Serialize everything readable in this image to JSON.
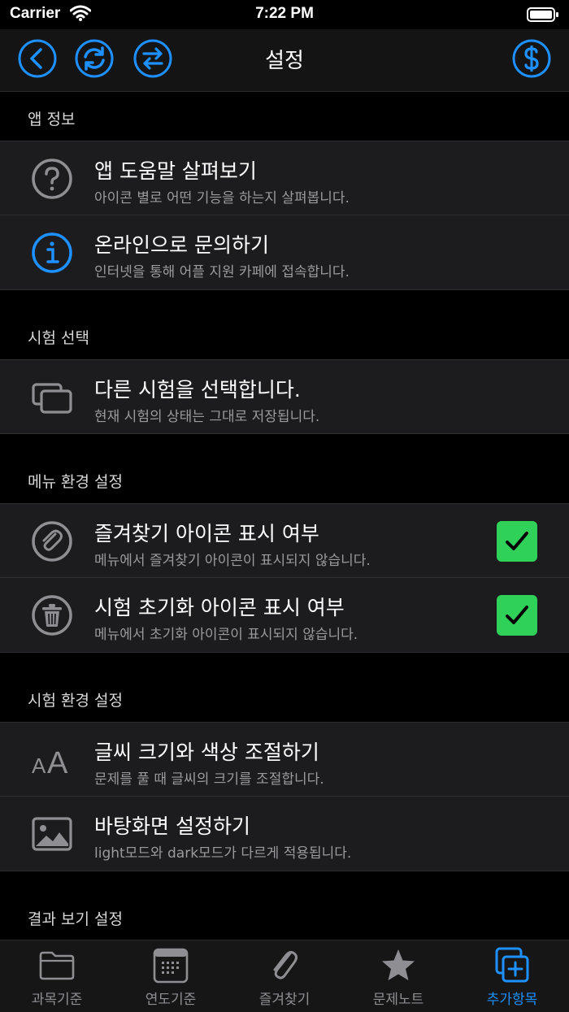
{
  "status_bar": {
    "carrier": "Carrier",
    "time": "7:22 PM"
  },
  "nav": {
    "title": "설정"
  },
  "colors": {
    "accent": "#1e90ff",
    "check": "#30d158",
    "row_bg": "#1c1c1e"
  },
  "sections": [
    {
      "header": "앱 정보",
      "rows": [
        {
          "title": "앱 도움말 살펴보기",
          "subtitle": "아이콘 별로 어떤 기능을 하는지 살펴봅니다.",
          "icon": "question-circle-icon"
        },
        {
          "title": "온라인으로 문의하기",
          "subtitle": "인터넷을 통해 어플 지원 카페에 접속합니다.",
          "icon": "info-circle-icon"
        }
      ]
    },
    {
      "header": "시험 선택",
      "rows": [
        {
          "title": "다른 시험을 선택합니다.",
          "subtitle": "현재 시험의 상태는 그대로 저장됩니다.",
          "icon": "stacked-windows-icon"
        }
      ]
    },
    {
      "header": "메뉴 환경 설정",
      "rows": [
        {
          "title": "즐겨찾기 아이콘 표시 여부",
          "subtitle": "메뉴에서 즐겨찾기 아이콘이 표시되지 않습니다.",
          "icon": "paperclip-circle-icon",
          "checked": true
        },
        {
          "title": "시험 초기화 아이콘 표시 여부",
          "subtitle": "메뉴에서 초기화 아이콘이 표시되지 않습니다.",
          "icon": "trash-circle-icon",
          "checked": true
        }
      ]
    },
    {
      "header": "시험 환경 설정",
      "rows": [
        {
          "title": "글씨 크기와 색상 조절하기",
          "subtitle": "문제를 풀 때 글씨의 크기를 조절합니다.",
          "icon": "text-size-icon",
          "icon_text": "AA"
        },
        {
          "title": "바탕화면 설정하기",
          "subtitle": "light모드와 dark모드가 다르게 적용됩니다.",
          "icon": "photo-icon"
        }
      ]
    },
    {
      "header": "결과 보기 설정",
      "rows": []
    }
  ],
  "tabs": [
    {
      "label": "과목기준",
      "icon": "folder-icon",
      "active": false
    },
    {
      "label": "연도기준",
      "icon": "calendar-icon",
      "active": false
    },
    {
      "label": "즐겨찾기",
      "icon": "paperclip-icon",
      "active": false
    },
    {
      "label": "문제노트",
      "icon": "star-icon",
      "active": false
    },
    {
      "label": "추가항목",
      "icon": "add-stack-icon",
      "active": true
    }
  ]
}
